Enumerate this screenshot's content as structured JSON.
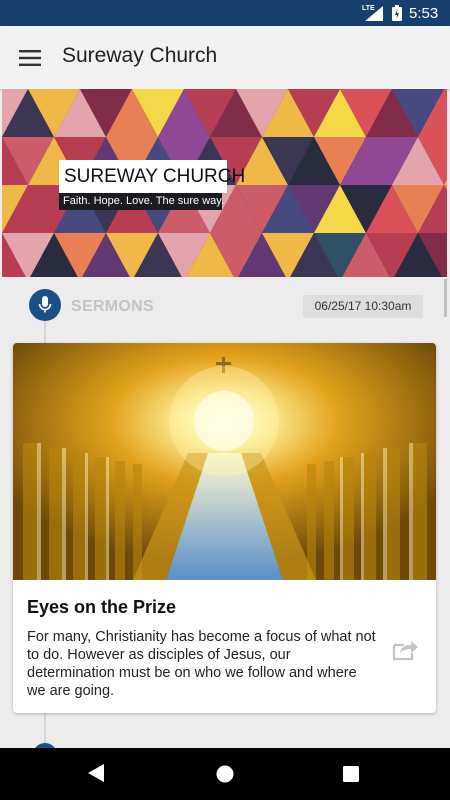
{
  "status_bar": {
    "network": "LTE",
    "time": "5:53",
    "icons": [
      "signal-icon",
      "battery-icon"
    ]
  },
  "app_bar": {
    "title": "Sureway Church",
    "menu_icon": "hamburger-menu-icon"
  },
  "banner": {
    "title": "SUREWAY CHURCH",
    "tagline": "Faith. Hope. Love. The sure way."
  },
  "feed": {
    "category": {
      "label": "SERMONS",
      "icon": "microphone-icon"
    },
    "date": "06/25/17 10:30am",
    "card": {
      "title": "Eyes on the Prize",
      "description": "For many, Christianity has become a focus of what not to do.  However as disciples of Jesus, our determination must be on who we follow and where we are going.",
      "share_icon": "share-icon"
    }
  },
  "colors": {
    "status_bar": "#17406f",
    "accent": "#1d4f87",
    "app_bar": "#f2f2f2"
  },
  "nav": {
    "icons": [
      "back-icon",
      "home-icon",
      "recents-icon"
    ]
  }
}
